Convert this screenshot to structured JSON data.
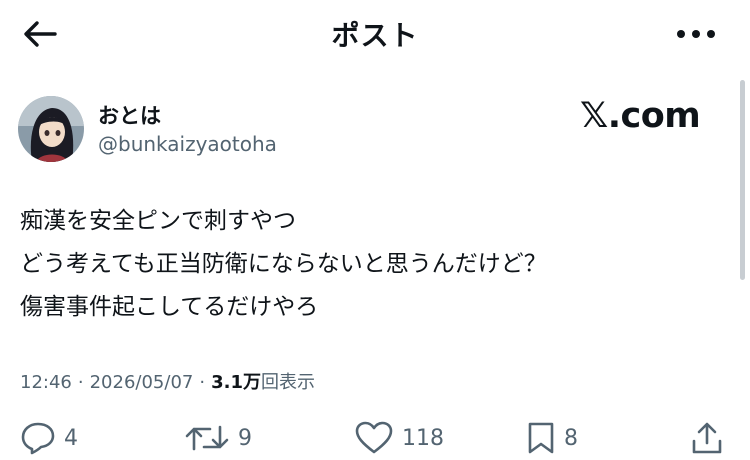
{
  "nav": {
    "title": "ポスト",
    "back_icon": "arrow-left-icon",
    "more_icon": "more-horizontal-icon"
  },
  "author": {
    "display_name": "おとは",
    "handle": "@bunkaizyaotoha",
    "avatar_icon": "avatar-image"
  },
  "source": {
    "label": "𝕏.com"
  },
  "post": {
    "lines": [
      "痴漢を安全ピンで刺すやつ",
      "どう考えても正当防衛にならないと思うんだけど？",
      "傷害事件起こしてるだけやろ"
    ]
  },
  "meta": {
    "time": "12:46",
    "separator": "·",
    "date": "2026/05/07",
    "views_count": "3.1万",
    "views_label": "回表示"
  },
  "actions": {
    "reply": {
      "icon": "reply-icon",
      "count": "4"
    },
    "repost": {
      "icon": "repost-icon",
      "count": "9"
    },
    "like": {
      "icon": "heart-icon",
      "count": "118"
    },
    "bookmark": {
      "icon": "bookmark-icon",
      "count": "8"
    },
    "share": {
      "icon": "share-icon"
    }
  },
  "colors": {
    "text": "#0f1419",
    "secondary": "#536471",
    "background": "#ffffff"
  }
}
